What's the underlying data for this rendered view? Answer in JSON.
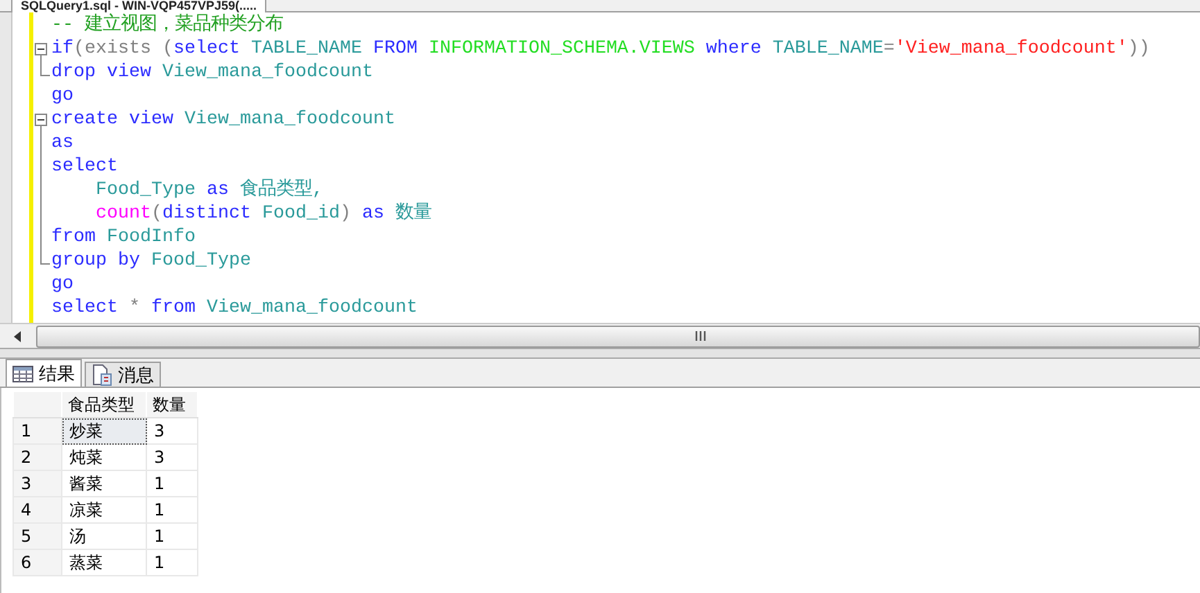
{
  "document_tab": {
    "title": "SQLQuery1.sql - WIN-VQP457VPJ59(....."
  },
  "editor": {
    "lines": [
      {
        "kind": "plain",
        "segments": [
          {
            "text": "-- 建立视图，菜品种类分布",
            "kind": "comment"
          }
        ]
      },
      {
        "kind": "fold-start",
        "segments": [
          {
            "text": "if",
            "kind": "keyword"
          },
          {
            "text": "(exists (",
            "kind": "operator"
          },
          {
            "text": "select",
            "kind": "keyword"
          },
          {
            "text": " TABLE_NAME ",
            "kind": "identifier"
          },
          {
            "text": "FROM",
            "kind": "keyword"
          },
          {
            "text": " INFORMATION_SCHEMA.VIEWS ",
            "kind": "system"
          },
          {
            "text": "where",
            "kind": "keyword"
          },
          {
            "text": " TABLE_NAME",
            "kind": "identifier"
          },
          {
            "text": "=",
            "kind": "operator"
          },
          {
            "text": "'View_mana_foodcount'",
            "kind": "string"
          },
          {
            "text": "))",
            "kind": "operator"
          }
        ]
      },
      {
        "kind": "fold-end",
        "segments": [
          {
            "text": "drop view",
            "kind": "keyword"
          },
          {
            "text": " View_mana_foodcount",
            "kind": "identifier"
          }
        ]
      },
      {
        "kind": "plain",
        "segments": [
          {
            "text": "go",
            "kind": "keyword"
          }
        ]
      },
      {
        "kind": "fold-start",
        "segments": [
          {
            "text": "create view",
            "kind": "keyword"
          },
          {
            "text": " View_mana_foodcount",
            "kind": "identifier"
          }
        ]
      },
      {
        "kind": "fold-body",
        "segments": [
          {
            "text": "as",
            "kind": "keyword"
          }
        ]
      },
      {
        "kind": "fold-body",
        "segments": [
          {
            "text": "select",
            "kind": "keyword"
          }
        ]
      },
      {
        "kind": "fold-body",
        "segments": [
          {
            "text": "    Food_Type ",
            "kind": "identifier"
          },
          {
            "text": "as",
            "kind": "keyword"
          },
          {
            "text": " 食品类型,",
            "kind": "identifier"
          }
        ]
      },
      {
        "kind": "fold-body",
        "segments": [
          {
            "text": "    count",
            "kind": "function"
          },
          {
            "text": "(",
            "kind": "operator"
          },
          {
            "text": "distinct",
            "kind": "keyword"
          },
          {
            "text": " Food_id",
            "kind": "identifier"
          },
          {
            "text": ")",
            "kind": "operator"
          },
          {
            "text": " as",
            "kind": "keyword"
          },
          {
            "text": " 数量",
            "kind": "identifier"
          }
        ]
      },
      {
        "kind": "fold-body",
        "segments": [
          {
            "text": "from",
            "kind": "keyword"
          },
          {
            "text": " FoodInfo",
            "kind": "identifier"
          }
        ]
      },
      {
        "kind": "fold-end",
        "segments": [
          {
            "text": "group by",
            "kind": "keyword"
          },
          {
            "text": " Food_Type",
            "kind": "identifier"
          }
        ]
      },
      {
        "kind": "plain",
        "segments": [
          {
            "text": "go",
            "kind": "keyword"
          }
        ]
      },
      {
        "kind": "plain",
        "segments": [
          {
            "text": "select",
            "kind": "keyword"
          },
          {
            "text": " * ",
            "kind": "operator"
          },
          {
            "text": "from",
            "kind": "keyword"
          },
          {
            "text": " View_mana_foodcount",
            "kind": "identifier"
          }
        ]
      }
    ]
  },
  "result_tabs": [
    {
      "label": "结果",
      "selected": true
    },
    {
      "label": "消息",
      "selected": false
    }
  ],
  "results": {
    "columns": [
      "食品类型",
      "数量"
    ],
    "rows": [
      {
        "number": "1",
        "cells": [
          {
            "text": "炒菜",
            "selected": true
          },
          {
            "text": "3",
            "selected": false
          }
        ]
      },
      {
        "number": "2",
        "cells": [
          {
            "text": "炖菜",
            "selected": false
          },
          {
            "text": "3",
            "selected": false
          }
        ]
      },
      {
        "number": "3",
        "cells": [
          {
            "text": "酱菜",
            "selected": false
          },
          {
            "text": "1",
            "selected": false
          }
        ]
      },
      {
        "number": "4",
        "cells": [
          {
            "text": "凉菜",
            "selected": false
          },
          {
            "text": "1",
            "selected": false
          }
        ]
      },
      {
        "number": "5",
        "cells": [
          {
            "text": "汤",
            "selected": false
          },
          {
            "text": "1",
            "selected": false
          }
        ]
      },
      {
        "number": "6",
        "cells": [
          {
            "text": "蒸菜",
            "selected": false
          },
          {
            "text": "1",
            "selected": false
          }
        ]
      }
    ]
  }
}
